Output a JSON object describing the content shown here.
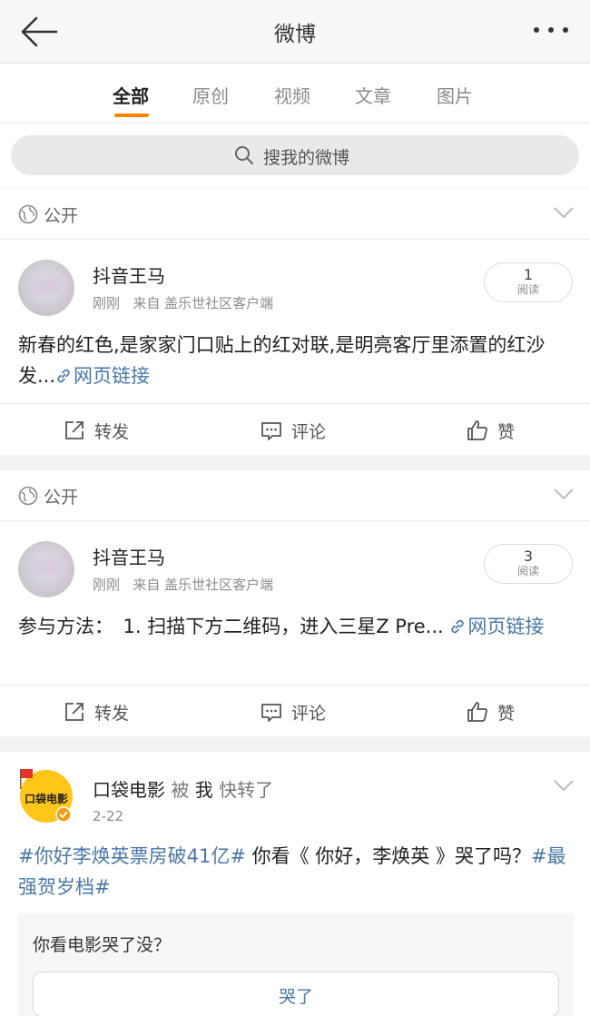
{
  "header": {
    "title": "微博"
  },
  "tabs": [
    {
      "label": "全部",
      "active": true
    },
    {
      "label": "原创"
    },
    {
      "label": "视频"
    },
    {
      "label": "文章"
    },
    {
      "label": "图片"
    }
  ],
  "search": {
    "placeholder": "搜我的微博"
  },
  "posts": [
    {
      "visibility": "公开",
      "author": "抖音王马",
      "time": "刚刚",
      "source": "来自 盖乐世社区客户端",
      "read_count": "1",
      "read_label": "阅读",
      "text": "新春的红色,是家家门口贴上的红对联,是明亮客厅里添置的红沙发...",
      "link_label": "网页链接",
      "actions": {
        "repost": "转发",
        "comment": "评论",
        "like": "赞"
      }
    },
    {
      "visibility": "公开",
      "author": "抖音王马",
      "time": "刚刚",
      "source": "来自 盖乐世社区客户端",
      "read_count": "3",
      "read_label": "阅读",
      "text": "参与方法：　1. 扫描下方二维码，进入三星Z Pre...",
      "link_label": "网页链接",
      "actions": {
        "repost": "转发",
        "comment": "评论",
        "like": "赞"
      }
    }
  ],
  "repost": {
    "author": "口袋电影",
    "by_word": "被",
    "by_user": "我",
    "action": "快转了",
    "date": "2-22",
    "tag1": "#你好李焕英票房破41亿#",
    "text_mid": " 你看《 你好，李焕英 》哭了吗？",
    "tag2": "#最强贺岁档#",
    "poll_question": "你看电影哭了没？",
    "poll_option": "哭了",
    "logo_text": "口袋电影"
  },
  "colors": {
    "accent": "#ff8200",
    "link": "#4a76a8",
    "background": "#f2f2f2"
  },
  "icons": [
    "back-arrow-icon",
    "more-dots-icon",
    "search-icon",
    "globe-icon",
    "chevron-down-icon",
    "link-icon",
    "repost-icon",
    "comment-icon",
    "like-icon",
    "verified-badge-icon"
  ]
}
